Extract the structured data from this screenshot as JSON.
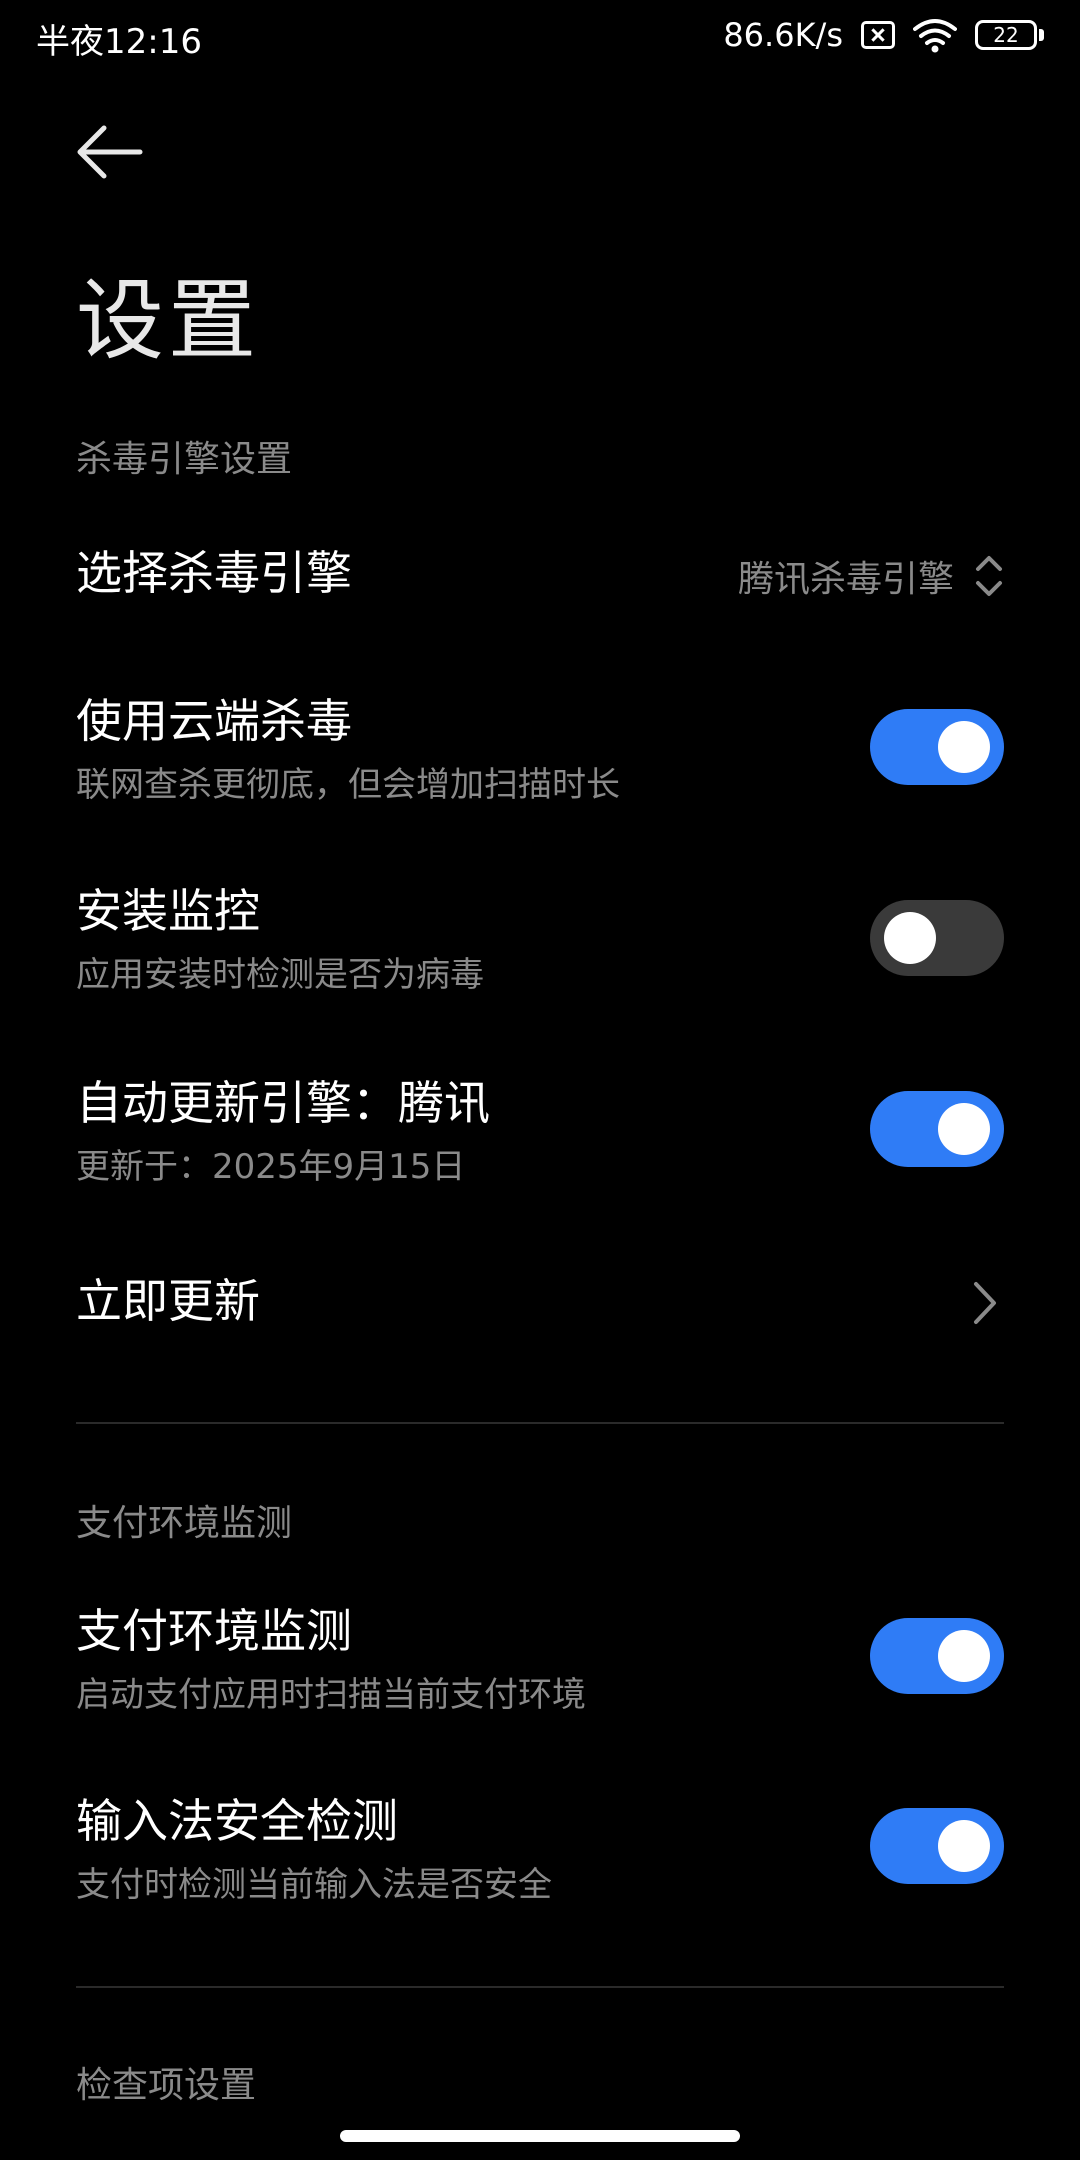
{
  "status_bar": {
    "time": "半夜12:16",
    "network_speed": "86.6K/s",
    "battery_level": "22"
  },
  "header": {
    "title": "设置"
  },
  "sections": {
    "engine": {
      "header": "杀毒引擎设置",
      "select_engine": {
        "title": "选择杀毒引擎",
        "value": "腾讯杀毒引擎"
      },
      "cloud_scan": {
        "title": "使用云端杀毒",
        "subtitle": "联网查杀更彻底，但会增加扫描时长",
        "enabled": true
      },
      "install_monitor": {
        "title": "安装监控",
        "subtitle": "应用安装时检测是否为病毒",
        "enabled": false
      },
      "auto_update": {
        "title": "自动更新引擎：腾讯",
        "subtitle": "更新于：2025年9月15日",
        "enabled": true
      },
      "update_now": {
        "title": "立即更新"
      }
    },
    "payment": {
      "header": "支付环境监测",
      "payment_env": {
        "title": "支付环境监测",
        "subtitle": "启动支付应用时扫描当前支付环境",
        "enabled": true
      },
      "ime_check": {
        "title": "输入法安全检测",
        "subtitle": "支付时检测当前输入法是否安全",
        "enabled": true
      }
    },
    "checks": {
      "header": "检查项设置"
    }
  },
  "colors": {
    "accent": "#2f7cf6",
    "background": "#000000",
    "secondary_text": "#8a8a8a"
  }
}
